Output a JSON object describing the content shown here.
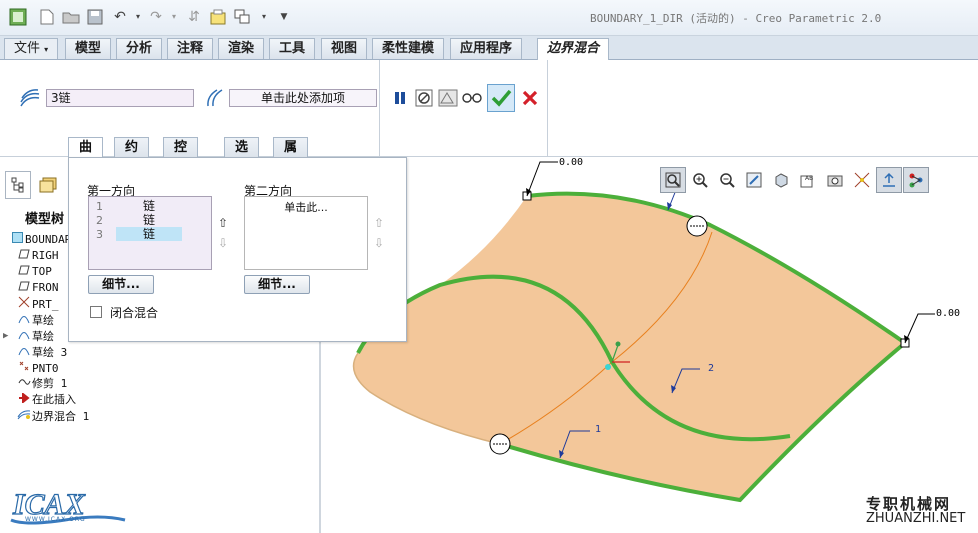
{
  "window": {
    "title": "BOUNDARY_1_DIR (活动的) - Creo Parametric 2.0"
  },
  "ribbon": {
    "tabs": [
      "文件",
      "模型",
      "分析",
      "注释",
      "渲染",
      "工具",
      "视图",
      "柔性建模",
      "应用程序"
    ],
    "active_tab": "边界混合"
  },
  "dashboard": {
    "first_collector": "3链",
    "second_collector": "单击此处添加项"
  },
  "subtabs": [
    "曲线",
    "约束",
    "控制点",
    "选项",
    "属性"
  ],
  "curves_panel": {
    "first_direction_label": "第一方向",
    "second_direction_label": "第二方向",
    "first_list": [
      {
        "n": "1",
        "v": "链"
      },
      {
        "n": "2",
        "v": "链"
      },
      {
        "n": "3",
        "v": "链"
      }
    ],
    "second_list_placeholder": "单击此...",
    "details_label": "细节...",
    "closed_blend_label": "闭合混合"
  },
  "model_tree": {
    "heading": "模型树",
    "items": [
      {
        "icon": "part-icon",
        "label": "BOUNDARY_"
      },
      {
        "icon": "datum-plane-icon",
        "label": "RIGH"
      },
      {
        "icon": "datum-plane-icon",
        "label": "TOP"
      },
      {
        "icon": "datum-plane-icon",
        "label": "FRON"
      },
      {
        "icon": "csys-icon",
        "label": "PRT_"
      },
      {
        "icon": "sketch-icon",
        "label": "草绘"
      },
      {
        "icon": "sketch-icon",
        "label": "草绘"
      },
      {
        "icon": "sketch-icon",
        "label": "草绘 3"
      },
      {
        "icon": "point-icon",
        "label": "PNT0"
      },
      {
        "icon": "trim-icon",
        "label": "修剪 1"
      },
      {
        "icon": "insert-here-icon",
        "label": "在此插入"
      },
      {
        "icon": "boundary-blend-icon",
        "label": "边界混合 1"
      }
    ]
  },
  "graphics": {
    "dim_top": "0.00",
    "dim_right": "0.00",
    "curve_label_1": "1",
    "curve_label_2": "2"
  },
  "watermark": {
    "cn": "专职机械网",
    "en": "ZHUANZHI.NET",
    "logo_url_text": "WWW.ICAX.ORG"
  },
  "colors": {
    "surface": "#f3c79a",
    "edge_green": "#4caf3a",
    "orange_curve": "#e8801e",
    "ok_green": "#2e9e35",
    "cancel_red": "#d4202a"
  }
}
